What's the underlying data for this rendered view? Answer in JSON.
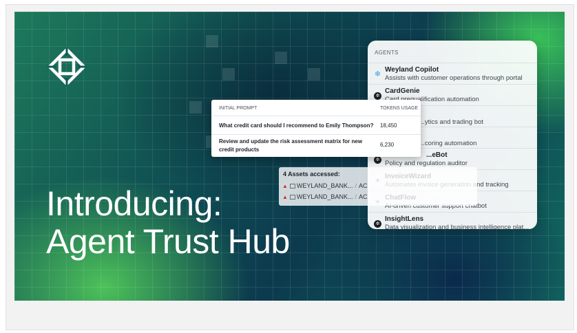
{
  "headline": {
    "line1": "Introducing:",
    "line2": "Agent Trust Hub"
  },
  "agents": {
    "header": "AGENTS",
    "items": [
      {
        "name": "Weyland Copilot",
        "desc": "Assists with customer operations through portal",
        "icon": "snowflake-icon",
        "color": "#29a8e0"
      },
      {
        "name": "CardGenie",
        "desc": "Card prequalification automation",
        "icon": "openai-icon",
        "color": "#1c2026"
      },
      {
        "name": "",
        "desc": "...ytics and trading bot",
        "icon": "",
        "color": ""
      },
      {
        "name": "",
        "desc": "...coring automation",
        "icon": "",
        "color": ""
      },
      {
        "name": "...eBot",
        "desc": "Policy and regulation auditor",
        "icon": "openai-icon",
        "color": "#1c2026"
      },
      {
        "name": "InvoiceWizard",
        "desc": "Automates invoice generation and tracking",
        "icon": "gemini-icon",
        "color": "#4b7cf0"
      },
      {
        "name": "ChatFlow",
        "desc": "AI-driven customer support chatbot",
        "icon": "gemini-icon",
        "color": "#4b7cf0"
      },
      {
        "name": "InsightLens",
        "desc": "Data visualization and business intelligence plat...",
        "icon": "openai-icon",
        "color": "#1c2026"
      }
    ]
  },
  "prompts": {
    "col_prompt": "INITIAL PROMPT",
    "col_tokens": "TOKENS USAGE",
    "rows": [
      {
        "prompt": "What credit card should I recommend to Emily Thompson?",
        "tokens": "18,450"
      },
      {
        "prompt": "Review and update the risk assessment matrix for new credit products",
        "tokens": "6,230"
      }
    ]
  },
  "assets": {
    "title": "4 Assets accessed:",
    "lines": [
      {
        "source": "WEYLAND_BANK...",
        "target": "AC"
      },
      {
        "source": "WEYLAND_BANK...",
        "target": "AC"
      }
    ]
  },
  "colors": {
    "warning": "#d4291f",
    "headline": "#ffffff"
  }
}
